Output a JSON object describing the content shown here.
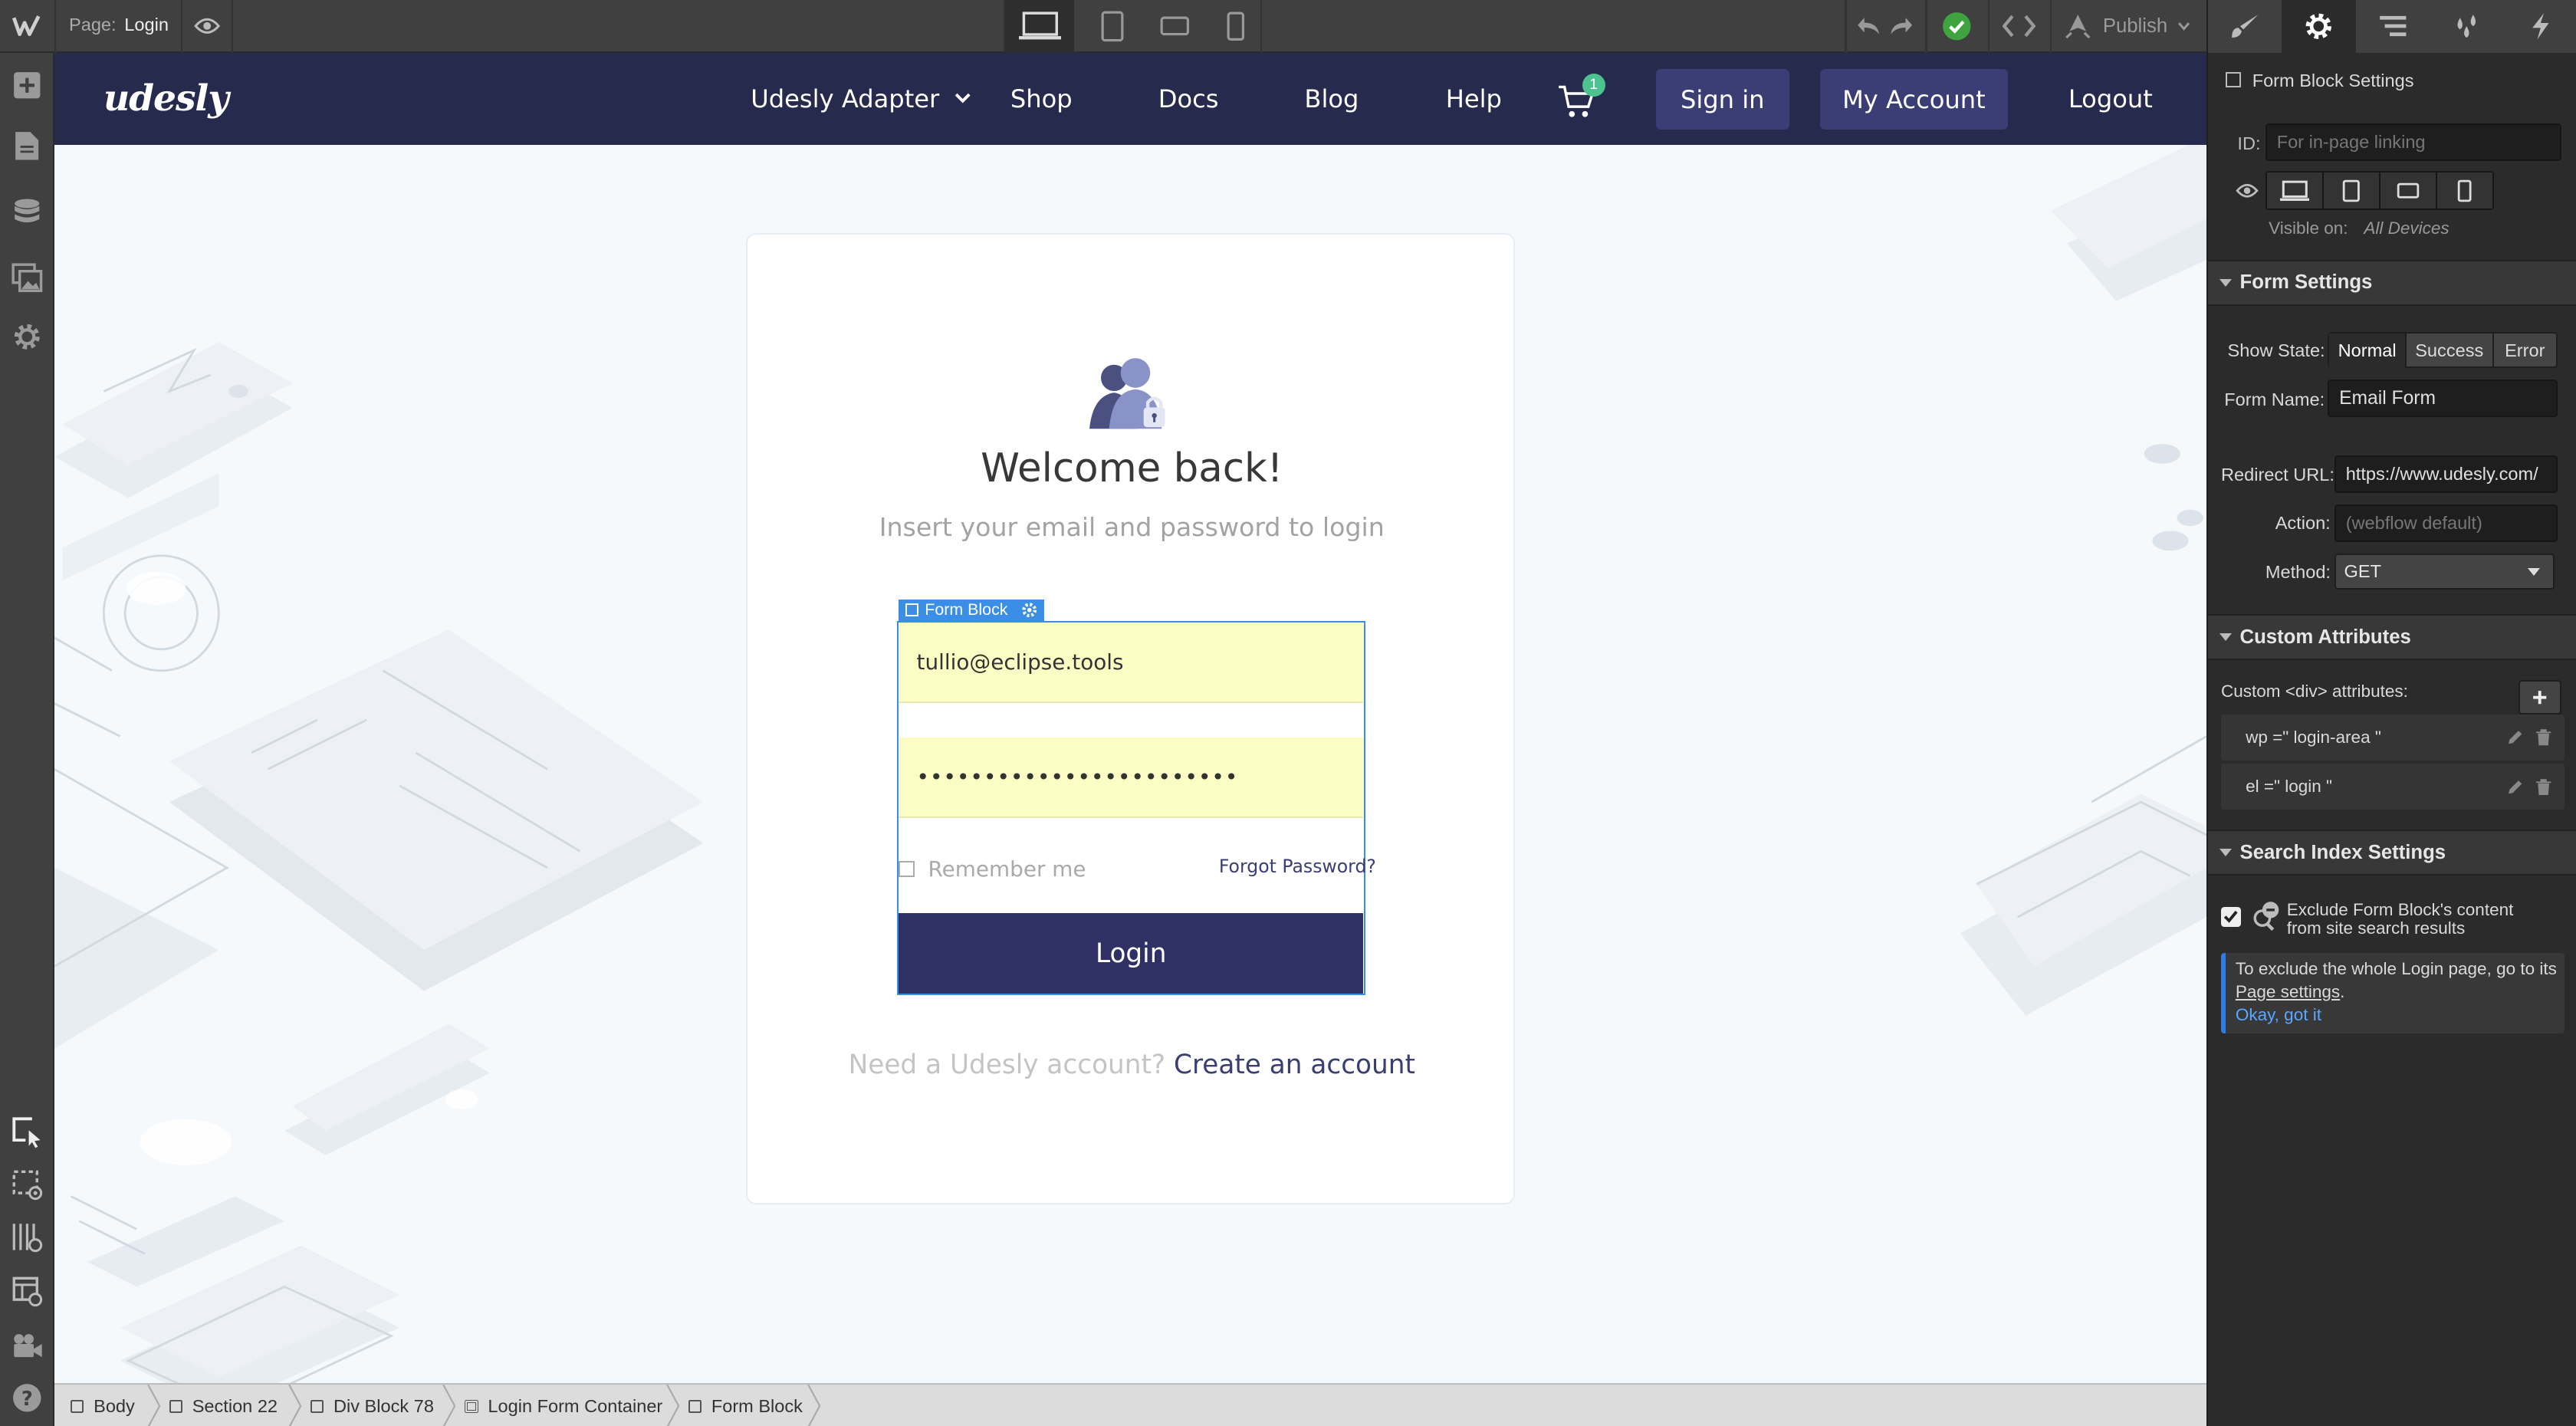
{
  "topbar": {
    "page_label": "Page:",
    "page_name": "Login",
    "publish_label": "Publish",
    "accent": "#3fa43f"
  },
  "site": {
    "logo": "udesly",
    "nav": [
      "Udesly Adapter",
      "Shop",
      "Docs",
      "Blog",
      "Help"
    ],
    "cart_count": "1",
    "sign_in": "Sign in",
    "my_account": "My Account",
    "logout": "Logout",
    "nav_bg": "#262a4c",
    "button_bg": "#3b3e75"
  },
  "card": {
    "title": "Welcome back!",
    "subtitle": "Insert your email and password to login",
    "form_block_tag": "Form Block",
    "email_value": "tullio@eclipse.tools",
    "password_value": "••••••••••••••••••••••••",
    "remember_label": "Remember me",
    "forgot_label": "Forgot Password?",
    "login_button": "Login",
    "need_account": "Need a Udesly account?",
    "create_account": "Create an account",
    "field_bg": "#fbfdc5",
    "selection_color": "#3b8ee6"
  },
  "breadcrumbs": [
    "Body",
    "Section 22",
    "Div Block 78",
    "Login Form Container",
    "Form Block"
  ],
  "panel": {
    "header_checkbox_label": "Form Block Settings",
    "id_label": "ID:",
    "id_placeholder": "For in-page linking",
    "visible_on_label": "Visible on:",
    "visible_on_value": "All Devices",
    "form_settings": {
      "title": "Form Settings",
      "show_state_label": "Show State:",
      "states": [
        "Normal",
        "Success",
        "Error"
      ],
      "form_name_label": "Form Name:",
      "form_name_value": "Email Form",
      "redirect_label": "Redirect URL:",
      "redirect_value": "https://www.udesly.com/",
      "action_label": "Action:",
      "action_placeholder": "(webflow default)",
      "method_label": "Method:",
      "method_value": "GET"
    },
    "custom_attributes": {
      "title": "Custom Attributes",
      "subtitle": "Custom <div> attributes:",
      "rows": [
        "wp =\" login-area \"",
        "el =\" login \""
      ]
    },
    "search_index": {
      "title": "Search Index Settings",
      "exclude_label_1": "Exclude Form Block's content",
      "exclude_label_2": "from site search results",
      "note_1": "To exclude the whole Login page, go to its",
      "note_link": "Page settings",
      "note_period": ".",
      "okay": "Okay, got it"
    }
  }
}
